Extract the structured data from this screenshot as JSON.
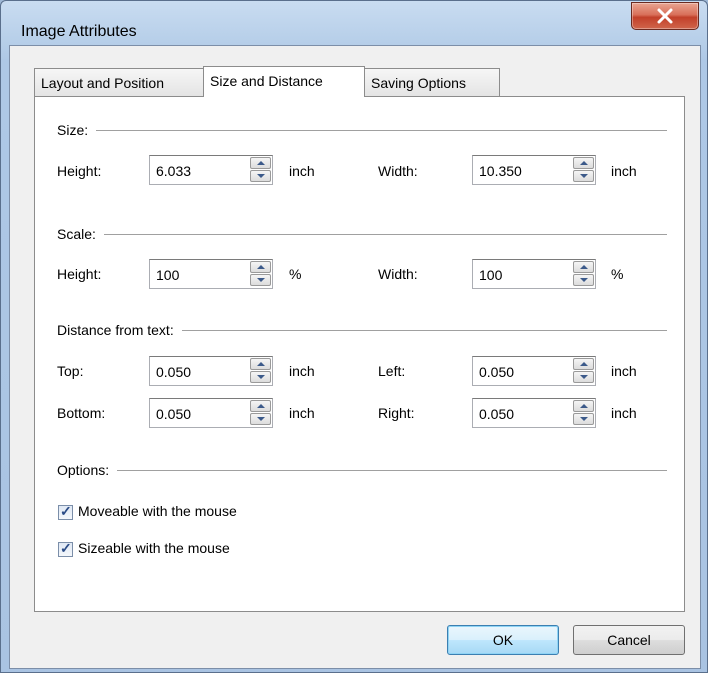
{
  "window": {
    "title": "Image Attributes"
  },
  "tabs": [
    {
      "label": "Layout and Position"
    },
    {
      "label": "Size and Distance"
    },
    {
      "label": "Saving Options"
    }
  ],
  "size": {
    "heading": "Size:",
    "height_label": "Height:",
    "height_value": "6.033",
    "height_unit": "inch",
    "width_label": "Width:",
    "width_value": "10.350",
    "width_unit": "inch"
  },
  "scale": {
    "heading": "Scale:",
    "height_label": "Height:",
    "height_value": "100",
    "height_unit": "%",
    "width_label": "Width:",
    "width_value": "100",
    "width_unit": "%"
  },
  "distance": {
    "heading": "Distance from text:",
    "top_label": "Top:",
    "top_value": "0.050",
    "top_unit": "inch",
    "left_label": "Left:",
    "left_value": "0.050",
    "left_unit": "inch",
    "bottom_label": "Bottom:",
    "bottom_value": "0.050",
    "bottom_unit": "inch",
    "right_label": "Right:",
    "right_value": "0.050",
    "right_unit": "inch"
  },
  "options": {
    "heading": "Options:",
    "moveable": {
      "label": "Moveable with the mouse",
      "checked": true
    },
    "sizeable": {
      "label": "Sizeable with the mouse",
      "checked": true
    }
  },
  "buttons": {
    "ok": "OK",
    "cancel": "Cancel"
  },
  "icons": {
    "close": "close-icon",
    "check": "check-icon",
    "spin_up": "spin-up-icon",
    "spin_down": "spin-down-icon"
  },
  "colors": {
    "title_bar": "#b7cfe9",
    "close_button": "#c2402a",
    "default_button_border": "#3c7fb1"
  }
}
